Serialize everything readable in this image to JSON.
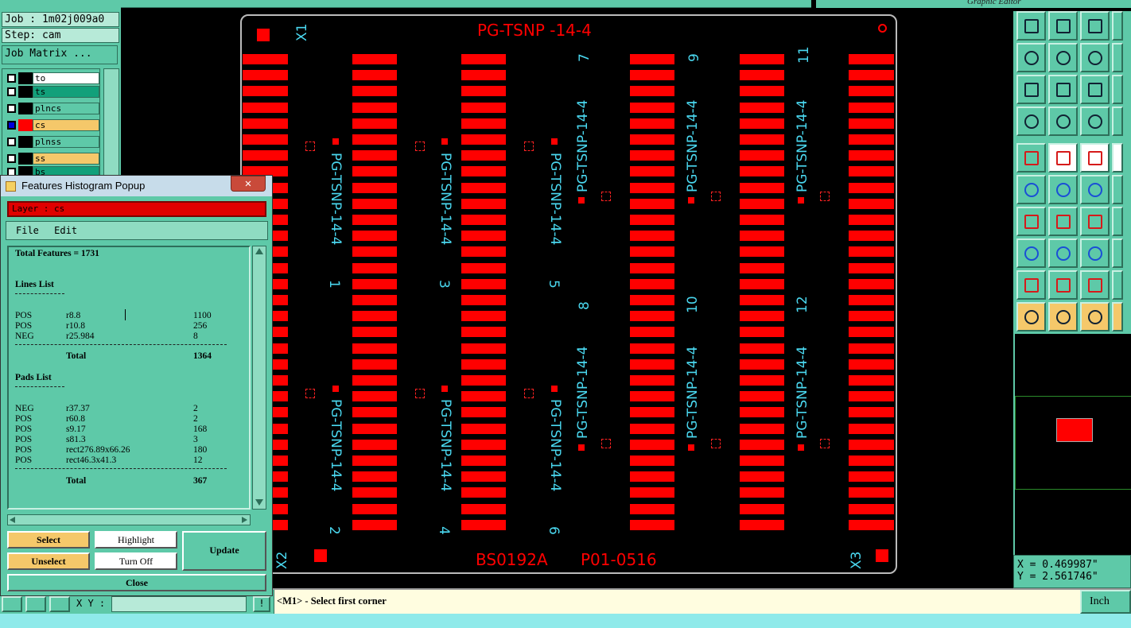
{
  "top": {
    "graphic_editor_label": "Graphic Editor"
  },
  "left": {
    "job_label": "Job : 1m02j009a0",
    "step_label": "Step: cam",
    "job_matrix_button": "Job Matrix ...",
    "layers": [
      {
        "name": "to",
        "color": "#ffffff",
        "swatch": "#000000",
        "selected": false
      },
      {
        "name": "ts",
        "color": "#12a07a",
        "swatch": "#000000",
        "selected": false
      },
      {
        "name": "plncs",
        "color": "#5ec9a8",
        "swatch": "#000000",
        "selected": false
      },
      {
        "name": "cs",
        "color": "#f5c86a",
        "swatch": "#ff0000",
        "selected": true
      },
      {
        "name": "plnss",
        "color": "#5ec9a8",
        "swatch": "#000000",
        "selected": false
      },
      {
        "name": "ss",
        "color": "#f5c86a",
        "swatch": "#000000",
        "selected": false
      },
      {
        "name": "bs",
        "color": "#12a07a",
        "swatch": "#000000",
        "selected": false
      }
    ]
  },
  "popup": {
    "title": "Features Histogram Popup",
    "layer_label": "Layer :  cs",
    "menu": {
      "file": "File",
      "edit": "Edit"
    },
    "total_features": "Total Features = 1731",
    "lines_header": "Lines List",
    "lines": [
      {
        "pol": "POS",
        "sym": "r8.8",
        "count": "1100"
      },
      {
        "pol": "POS",
        "sym": "r10.8",
        "count": "256"
      },
      {
        "pol": "NEG",
        "sym": "r25.984",
        "count": "8"
      }
    ],
    "lines_total_label": "Total",
    "lines_total": "1364",
    "pads_header": "Pads List",
    "pads": [
      {
        "pol": "NEG",
        "sym": "r37.37",
        "count": "2"
      },
      {
        "pol": "POS",
        "sym": "r60.8",
        "count": "2"
      },
      {
        "pol": "POS",
        "sym": "s9.17",
        "count": "168"
      },
      {
        "pol": "POS",
        "sym": "s81.3",
        "count": "3"
      },
      {
        "pol": "POS",
        "sym": "rect276.89x66.26",
        "count": "180"
      },
      {
        "pol": "POS",
        "sym": "rect46.3x41.3",
        "count": "12"
      }
    ],
    "pads_total_label": "Total",
    "pads_total": "367",
    "buttons": {
      "select": "Select",
      "highlight": "Highlight",
      "update": "Update",
      "unselect": "Unselect",
      "turn_off": "Turn Off",
      "close": "Close"
    }
  },
  "board": {
    "title": "PG-TSNP   -14-4",
    "bottom_code": "BS0192A",
    "bottom_part": "P01-0516",
    "fiducials": {
      "x1": "X1",
      "x2": "X2",
      "x3": "X3"
    },
    "upper_left_labels": [
      "PG-TSNP-14-4",
      "PG-TSNP-14-4",
      "PG-TSNP-14-4"
    ],
    "upper_left_nums": [
      "1",
      "3",
      "5"
    ],
    "upper_right_labels": [
      "PG-TSNP-14-4",
      "PG-TSNP-14-4",
      "PG-TSNP-14-4"
    ],
    "upper_right_nums": [
      "7",
      "9",
      "11"
    ],
    "lower_left_labels": [
      "PG-TSNP-14-4",
      "PG-TSNP-14-4",
      "PG-TSNP-14-4"
    ],
    "lower_left_nums": [
      "2",
      "4",
      "6"
    ],
    "lower_right_labels": [
      "PG-TSNP-14-4",
      "PG-TSNP-14-4",
      "PG-TSNP-14-4"
    ],
    "lower_right_nums": [
      "8",
      "10",
      "12"
    ]
  },
  "coords": {
    "x": "X = 0.469987\"",
    "y": "Y = 2.561746\"",
    "units": "Inch"
  },
  "status": {
    "prompt": "<M1> - Select first corner",
    "xy_label": "X Y :"
  }
}
